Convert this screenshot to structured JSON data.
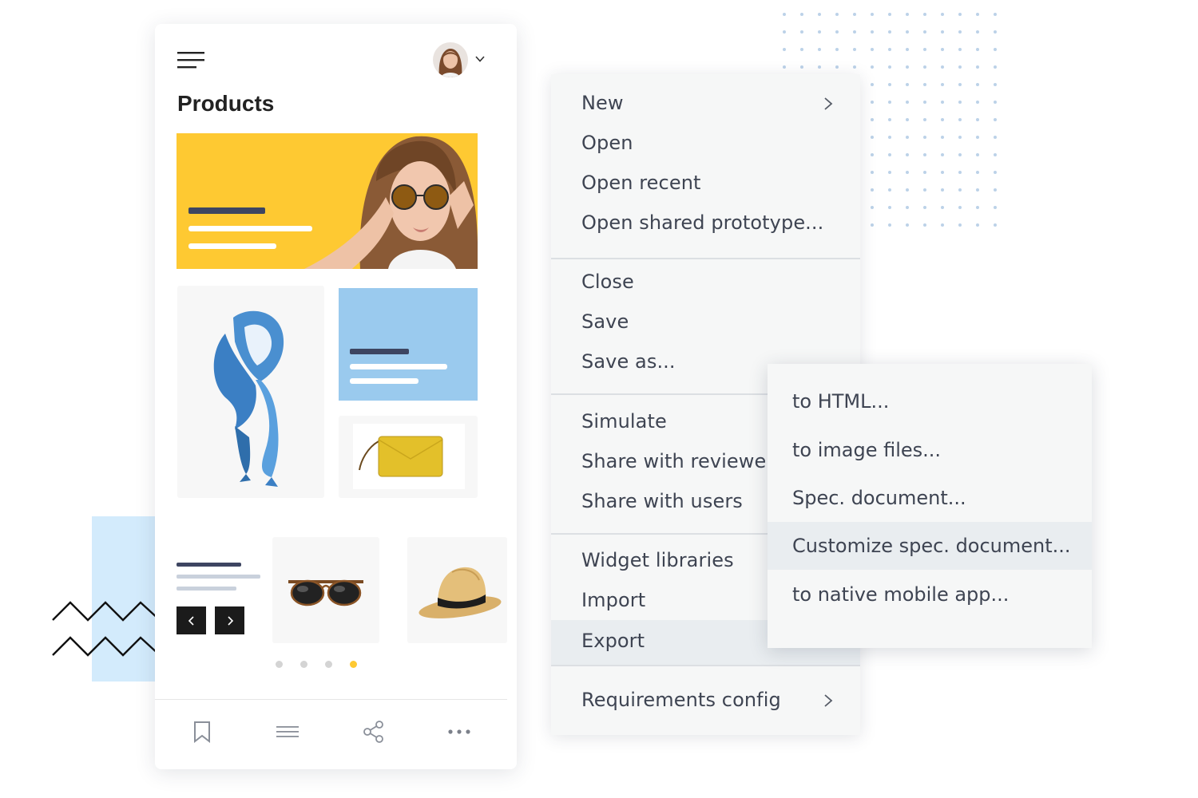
{
  "screen": {
    "title": "Products",
    "colors": {
      "accent_yellow": "#fec932",
      "accent_blue": "#9acaee",
      "text_dark": "#222222",
      "menu_text": "#3e4452",
      "menu_bg": "#f6f7f7",
      "menu_highlight": "#e9edf0"
    },
    "header": {
      "menu_icon": "hamburger-icon",
      "avatar_icon": "user-avatar",
      "dropdown_icon": "chevron-down-icon"
    },
    "carousel": {
      "prev_icon": "chevron-left-icon",
      "next_icon": "chevron-right-icon",
      "page_count": 4,
      "active_page": 4
    },
    "bottom_nav": [
      {
        "icon": "bookmark-icon"
      },
      {
        "icon": "list-icon"
      },
      {
        "icon": "share-icon"
      },
      {
        "icon": "more-horizontal-icon"
      }
    ]
  },
  "menu": {
    "groups": [
      {
        "items": [
          {
            "label": "New",
            "has_submenu": true
          },
          {
            "label": "Open"
          },
          {
            "label": "Open recent"
          },
          {
            "label": "Open shared prototype..."
          }
        ]
      },
      {
        "items": [
          {
            "label": "Close"
          },
          {
            "label": "Save"
          },
          {
            "label": "Save as..."
          }
        ]
      },
      {
        "items": [
          {
            "label": "Simulate"
          },
          {
            "label": "Share with reviewers"
          },
          {
            "label": "Share with users"
          }
        ]
      },
      {
        "items": [
          {
            "label": "Widget libraries"
          },
          {
            "label": "Import"
          },
          {
            "label": "Export",
            "active": true,
            "has_submenu": true
          }
        ]
      },
      {
        "items": [
          {
            "label": "Requirements config",
            "has_submenu": true
          }
        ]
      }
    ],
    "submenu_icon": "chevron-right-icon"
  },
  "export_submenu": {
    "items": [
      {
        "label": "to HTML..."
      },
      {
        "label": "to image files..."
      },
      {
        "label": "Spec. document..."
      },
      {
        "label": "Customize spec. document...",
        "active": true
      },
      {
        "label": "to native mobile app..."
      }
    ]
  }
}
